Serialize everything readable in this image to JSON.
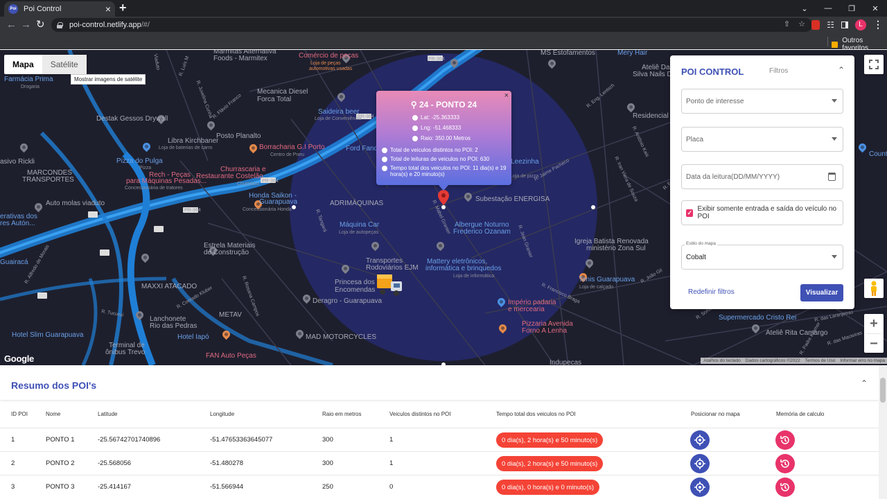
{
  "browser": {
    "tab_title": "Poi Control",
    "favicon_text": "Poi",
    "url_host": "poi-control.netlify.app",
    "url_path": "/#/",
    "bookmark_folder": "Outros favoritos",
    "profile_initial": "L",
    "new_tab_glyph": "+",
    "close_glyph": "×"
  },
  "map": {
    "type_buttons": {
      "map": "Mapa",
      "satellite": "Satélite"
    },
    "tooltip": "Mostrar imagens de satélite",
    "google_logo": "Google",
    "attribution": [
      "Atalhos do teclado",
      "Dados cartográficos ©2022",
      "Termos de Uso",
      "Informar erro no mapa"
    ],
    "labels": [
      "Marmitas Alternativa",
      "Foods - Marmitex",
      "Comércio de peças",
      "Loja de peças",
      "automotivas usadas",
      "MS Estofamentos",
      "Mery Hair",
      "Ateliê Dal",
      "Silva Nails D",
      "Farmácia Prima",
      "Drogaria",
      "Mecanica Diesel",
      "Forca Total",
      "Saideira beer",
      "Loja de Conveniência",
      "Destak Gessos Drywall",
      "Libra Kirchbaner",
      "Loja de baterias de carro",
      "Posto Planalto",
      "Borracharia G.I Porto",
      "Centro de Pneu",
      "Ford Fanc",
      "Residencial Corra",
      "Pizza do Pulga",
      "Pizza",
      "Rech - Peças",
      "para Máquinas Pesadas...",
      "Concessionária de tratores",
      "Churrascaria e",
      "Restaurante Costelão",
      "Churrasco",
      "asivo Rickli",
      "MARCONDES",
      "TRANSPORTES",
      "Auto molas viaduto",
      "Honda Saikon -",
      "Guarapuava",
      "Concessionária Honda",
      "ADRIMÁQUINAS",
      "Subestação ENERGISA",
      "Máquina Car",
      "Loja de autopeças",
      "Albergue Noturno",
      "Frederico Ozanam",
      "Estrela Materiais",
      "de Construção",
      "Transportes",
      "Rodoviários EJM",
      "Mattery eletrônicos,",
      "informática e brinquedos",
      "Loja de informática",
      "Igreja Batista Renovada",
      "ministério Zona Sul",
      "Tenis Guarapuava",
      "Loja de calçado",
      "Princesa dos C",
      "Encomendas",
      "MAXXI ATACADO",
      "Deragro - Guarapuava",
      "Império padaria",
      "e mercearia",
      "Lanchonete",
      "Rio das Pedras",
      "METAV",
      "Pizzaria Avenida",
      "Forno A Lenha",
      "Supermercado Cristo Rei",
      "Hotel Slim Guarapuava",
      "Hotel Iapó",
      "MAD MOTORCYCLES",
      "Ateliê Rita Camargo",
      "Terminal de",
      "ônibus Trevo",
      "FAN Auto Peças",
      "Indupecas",
      "Guairacá",
      "erativas dos",
      "res Autón...",
      "Loja de pizza",
      "Leezinha",
      "Count"
    ],
    "roads": [
      "PR-364",
      "R. Luís M",
      "Viaduto",
      "R. Flávio Franco",
      "R. Juvelina Cunha",
      "R. Eng. Lentsch",
      "R. Antônio Kais",
      "R. Jaime Pacheco",
      "R. Iran Viera de Souza",
      "R. Eulália",
      "R. Mabel Granier",
      "R. Jean Granier",
      "R. Tangará",
      "R. Alfredo de Morais",
      "R. Conrado Kluber",
      "R. Rosana Campos",
      "R. Tucuruí",
      "R. Francisco Braga",
      "R. Sorocaba",
      "R. das Laranjeiras",
      "R. das Macieiras",
      "R. Padre Kramer",
      "R. João Gil"
    ]
  },
  "info_window": {
    "title": "24 - PONTO 24",
    "lat": "Lat: -25.363333",
    "lng": "Lng: -51.468333",
    "radius": "Raio: 350.00 Metros",
    "distinct_vehicles": "Total de veiculos distintos no POI: 2",
    "readings": "Total de leituras de veiculos no POI: 630",
    "total_time": "Tempo total dos veiculos no POI: 11 dia(s) e 19 hora(s) e 20 minuto(s)",
    "close": "×"
  },
  "filter_panel": {
    "title": "POI CONTROL",
    "tab": "Filtros",
    "poi_placeholder": "Ponto de interesse",
    "plate_placeholder": "Placa",
    "date_placeholder": "Data da leitura(DD/MM/YYYY)",
    "checkbox_label": "Exibir somente entrada e saída do veículo no POI",
    "checkbox_checked": true,
    "map_style_label": "Estilo do mapa",
    "map_style_value": "Cobalt",
    "reset_label": "Redefinir filtros",
    "view_label": "Visualizar"
  },
  "summary": {
    "title": "Resumo dos POI's",
    "headers": [
      "ID POI",
      "Nome",
      "Latitude",
      "Longitude",
      "Raio em metros",
      "Veiculos distintos no POI",
      "Tempo total dos veiculos no POI",
      "Posicionar no mapa",
      "Memória de calculo"
    ],
    "rows": [
      {
        "id": "1",
        "name": "PONTO 1",
        "lat": "-25.56742701740896",
        "lng": "-51.47653363645077",
        "radius": "300",
        "vehicles": "1",
        "time": "0 dia(s), 2 hora(s) e 50 minuto(s)"
      },
      {
        "id": "2",
        "name": "PONTO 2",
        "lat": "-25.568056",
        "lng": "-51.480278",
        "radius": "300",
        "vehicles": "1",
        "time": "0 dia(s), 2 hora(s) e 50 minuto(s)"
      },
      {
        "id": "3",
        "name": "PONTO 3",
        "lat": "-25.414167",
        "lng": "-51.566944",
        "radius": "250",
        "vehicles": "0",
        "time": "0 dia(s), 0 hora(s) e 0 minuto(s)"
      }
    ]
  },
  "colors": {
    "primary": "#3f51b5",
    "accent": "#e8336a",
    "danger": "#f44336",
    "map_bg": "#1e1f2d",
    "road": "#2b8fe3",
    "poi_circle": "#2a2f7a"
  }
}
